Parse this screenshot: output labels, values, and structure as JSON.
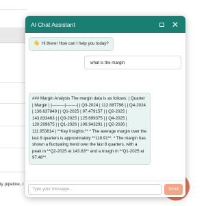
{
  "background": {
    "fragment_text": "ly pipeline, r"
  },
  "chat": {
    "title": "AI Chat Assistant",
    "header_icons": [
      "maximize-icon",
      "close-icon"
    ],
    "greeting": "Hi there! How can I help you today?",
    "greeting_icon": "waving-hand-icon",
    "user_message": "what is the margin",
    "assistant_message": "### Margin Analysis The margin data is as follows: | Quarter | Margin | |---------|--------| | Q3-2024 | 112.887796 | | Q4-2024 | 136.637849 | | Q1-2025 | 97.479157 | | Q2-2025 | 143.833463 | | Q3-2025 | 125.699375 | | Q4-2025 | 120.209675 | | Q1-2026 | 106.943291 | | Q2-2026 | 111.953814 | **Key Insights:** * The average margin over the last 8 quarters is approximately **118.91**. * The margin has shown a fluctuating trend over the last 8 quarters, with a peak in **Q2-2025 at 143.83** and a trough in **Q1-2025 at 97.48**.",
    "input_placeholder": "Type your message...",
    "send_label": "Send",
    "colors": {
      "header": "#1a7f73",
      "bot_bubble": "#e8f4f2",
      "send_button": "#f3a584",
      "fab": "#e8643c"
    }
  }
}
